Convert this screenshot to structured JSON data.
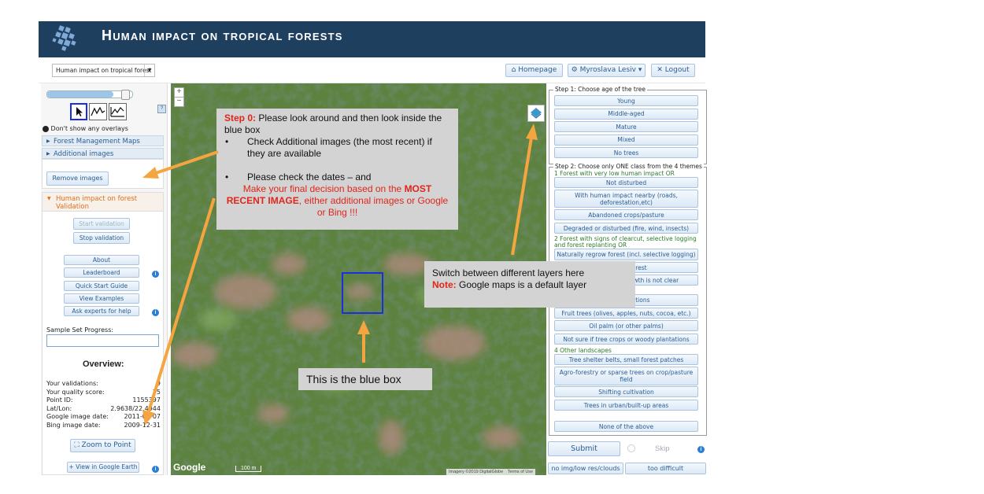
{
  "header": {
    "title": "Human impact on tropical forests"
  },
  "topbar": {
    "project_select": "Human impact on tropical forest",
    "homepage": "Homepage",
    "user": "Myroslava Lesiv",
    "logout": "Logout"
  },
  "left": {
    "overlay_option": "Don't show any overlays",
    "forest_maps": "Forest Management Maps",
    "additional_images": "Additional images",
    "remove_images": "Remove images",
    "validation_title": "Human impact on forest Validation",
    "start_validation": "Start validation",
    "stop_validation": "Stop validation",
    "about": "About",
    "leaderboard": "Leaderboard",
    "quick_start": "Quick Start Guide",
    "view_examples": "View Examples",
    "ask_experts": "Ask experts for help",
    "sample_progress": "Sample Set Progress:",
    "overview_title": "Overview:",
    "overview": [
      {
        "label": "Your validations:",
        "value": "9"
      },
      {
        "label": "Your quality score:",
        "value": "75"
      },
      {
        "label": "Point ID:",
        "value": "1155397"
      },
      {
        "label": "Lat/Lon:",
        "value": "2.9638/22.4944"
      },
      {
        "label": "Google image date:",
        "value": "2011-05-07"
      },
      {
        "label": "Bing image date:",
        "value": "2009-12-31"
      }
    ],
    "zoom_to_point": "Zoom to Point",
    "google_earth": "View in Google Earth",
    "slider_level": 0.78
  },
  "map": {
    "google_logo": "Google",
    "imagery_credit": "Imagery ©2019 DigitalGlobe",
    "terms": "Terms of Use",
    "scale": "100 m"
  },
  "right": {
    "step1_title": "Step 1: Choose age of the tree",
    "age_options": [
      "Young",
      "Middle-aged",
      "Mature",
      "Mixed",
      "No trees"
    ],
    "step2_title": "Step 2: Choose only ONE class from the 4 themes",
    "group1": "1 Forest with very low human impact OR",
    "group1_options": [
      "Not disturbed",
      "With human impact nearby (roads, deforestation,etc)",
      "Abandoned crops/pasture",
      "Degraded or disturbed (fire, wind, insects)"
    ],
    "group2": "2 Forest with signs of clearcut, selective logging and forest replanting OR",
    "group2_options": [
      "Naturally regrow forest (incl. selective logging)",
      "Planted forest",
      "Not sure if the regrowth is not clear"
    ],
    "group3_options": [
      "Tree plantations",
      "Fruit trees (olives, apples, nuts, cocoa, etc.)",
      "Oil palm (or other palms)",
      "Not sure if tree crops or woody plantations"
    ],
    "group4": "4 Other landscapes",
    "group4_options": [
      "Tree shelter belts, small forest patches",
      "Agro-forestry or sparse trees on crop/pasture field",
      "Shifting cultivation",
      "Trees in urban/built-up areas"
    ],
    "none": "None of the above",
    "submit": "Submit",
    "skip": "Skip",
    "no_img": "no img/low res/clouds",
    "too_difficult": "too difficult"
  },
  "annotations": {
    "step0_label": "Step 0:",
    "step0_text": " Please look around  and then look inside the blue box",
    "bullet1": "Check Additional images (the most recent) if they are available",
    "bullet2": "Please check the dates – and",
    "final_a": "Make your final decision based on the ",
    "final_b": "MOST RECENT IMAGE",
    "final_c": ", either additional images or Google or Bing !!!",
    "layers_line": "Switch between different  layers here",
    "note_label": "Note:",
    "note_text": " Google maps is a default layer",
    "bluebox_text": "This is the blue box"
  },
  "colors": {
    "header": "#1f3f5e",
    "accent": "#2a5e93",
    "callout": "#d3d3d3",
    "arrow": "#f5a540",
    "blue_box": "#1a2fe0",
    "note_red": "#e0251b"
  }
}
